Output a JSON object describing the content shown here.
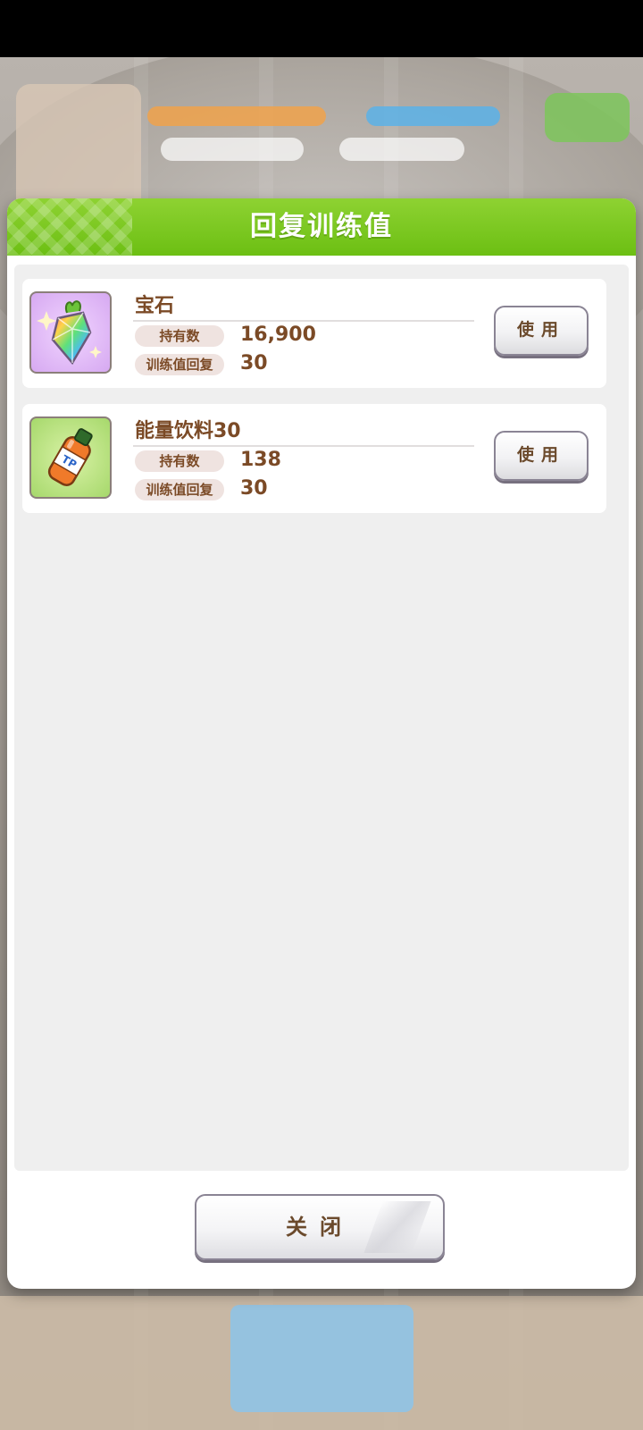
{
  "dialog": {
    "title": "回复训练值",
    "items": [
      {
        "name": "宝石",
        "icon": "rainbow-gem-icon",
        "own_label": "持有数",
        "own_value": "16,900",
        "recover_label": "训练值回复",
        "recover_value": "30",
        "button_label": "使用"
      },
      {
        "name": "能量饮料30",
        "icon": "energy-drink-icon",
        "own_label": "持有数",
        "own_value": "138",
        "recover_label": "训练值回复",
        "recover_value": "30",
        "button_label": "使用"
      }
    ],
    "close_label": "关闭"
  },
  "colors": {
    "header_green": "#6cbf13",
    "text_brown": "#7b4a26",
    "panel_gray": "#efefef"
  }
}
